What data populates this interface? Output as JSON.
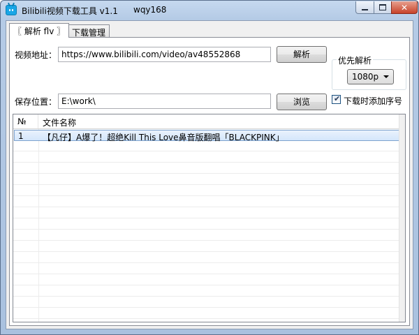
{
  "window": {
    "title": "Bilibili视频下载工具 v1.1",
    "author": "wqy168",
    "controls": {
      "minimize_icon": "minimize-icon",
      "maximize_icon": "maximize-icon",
      "close_icon": "close-icon",
      "close_glyph": "✕"
    }
  },
  "tabs": [
    {
      "label": "〖 解析 flv 〗",
      "active": true
    },
    {
      "label": "下载管理",
      "active": false
    }
  ],
  "form": {
    "url_label": "视频地址：",
    "url_value": "https://www.bilibili.com/video/av48552868",
    "parse_button": "解析",
    "save_label": "保存位置：",
    "save_value": "E:\\work\\",
    "browse_button": "浏览",
    "priority_group_title": "优先解析",
    "quality_selected": "1080p",
    "add_index_label": "下载时添加序号",
    "add_index_checked": true,
    "checkmark": "✔"
  },
  "list": {
    "columns": [
      "№",
      "文件名称"
    ],
    "rows": [
      {
        "no": "1",
        "name": "【凡仔】A爆了！超绝Kill This Love鼻音版翻唱「BLACKPINK」",
        "selected": true
      }
    ]
  },
  "colors": {
    "accent": "#19a6e6",
    "selection": "#d4e6fb",
    "frame": "#a9c1df"
  }
}
